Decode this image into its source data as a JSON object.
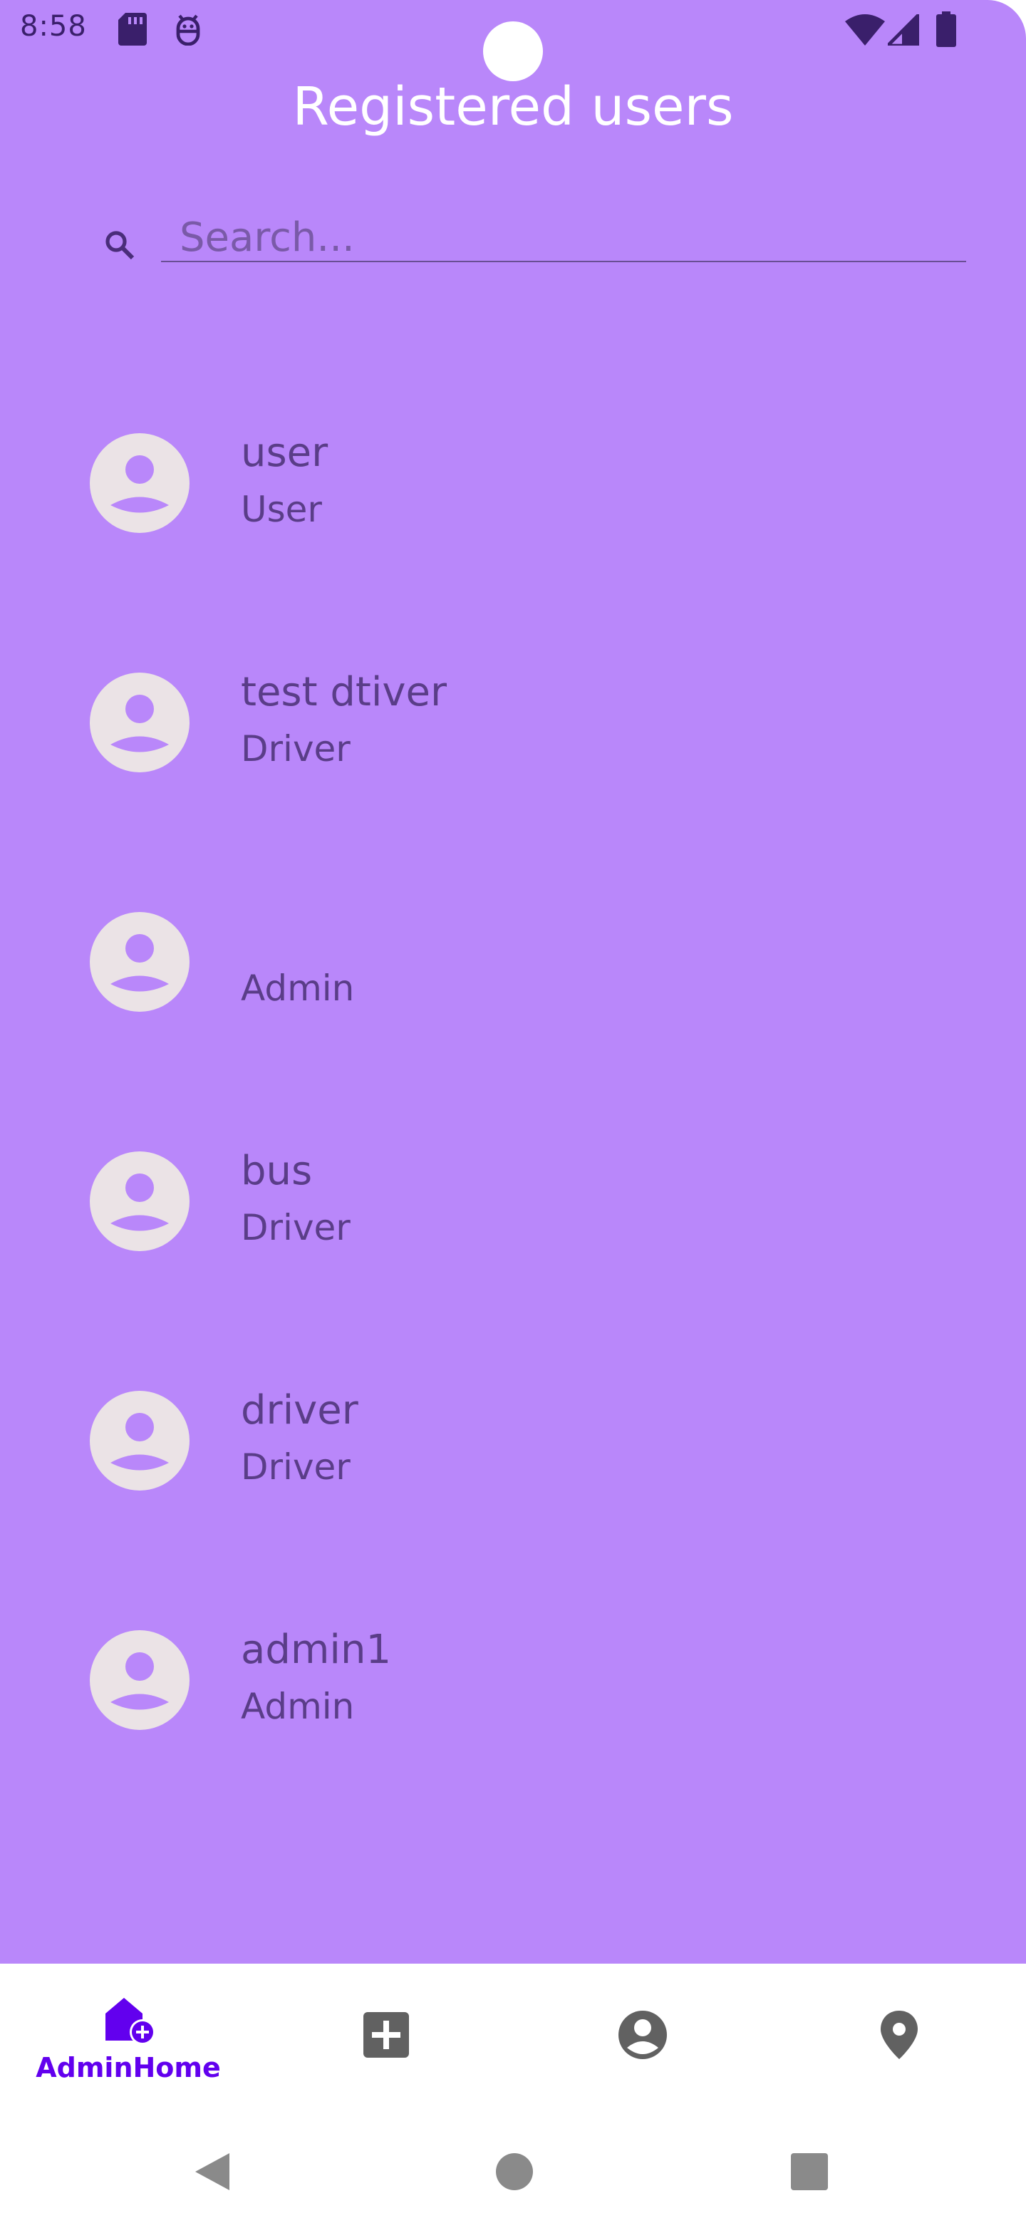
{
  "status_bar": {
    "time": "8:58",
    "icons": [
      "sd-card-icon",
      "android-debug-icon",
      "wifi-icon",
      "signal-icon",
      "battery-icon"
    ]
  },
  "header": {
    "title": "Registered users"
  },
  "search": {
    "placeholder": "Search...",
    "value": ""
  },
  "users": [
    {
      "name": "user",
      "role": "User"
    },
    {
      "name": "test dtiver",
      "role": "Driver"
    },
    {
      "name": "",
      "role": "Admin"
    },
    {
      "name": "bus",
      "role": "Driver"
    },
    {
      "name": "driver",
      "role": "Driver"
    },
    {
      "name": "admin1",
      "role": "Admin"
    }
  ],
  "bottom_nav": {
    "items": [
      {
        "icon": "admin-home-icon",
        "label": "AdminHome",
        "selected": true
      },
      {
        "icon": "add-box-icon",
        "label": "",
        "selected": false
      },
      {
        "icon": "account-circle-icon",
        "label": "",
        "selected": false
      },
      {
        "icon": "location-pin-icon",
        "label": "",
        "selected": false
      }
    ]
  },
  "colors": {
    "background": "#b987fa",
    "accent": "#6200ee",
    "text": "#5a3d88",
    "nav_icon": "#616161",
    "avatar": "#ebe3e6"
  }
}
